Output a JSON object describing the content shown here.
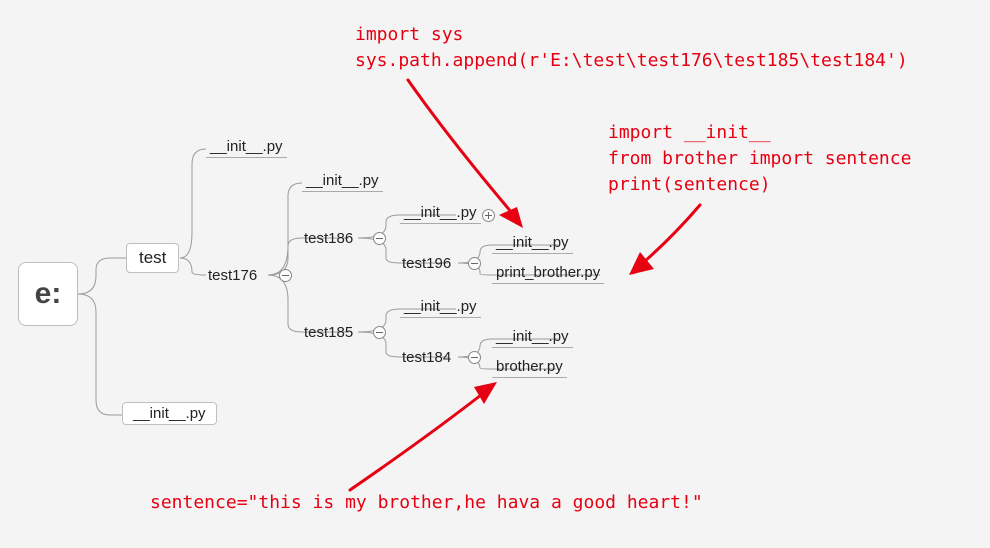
{
  "root": {
    "label": "e:"
  },
  "lvl1": {
    "test": "test",
    "init": "__init__.py"
  },
  "lvl2": {
    "init": "__init__.py",
    "test176": "test176"
  },
  "lvl3": {
    "init": "__init__.py",
    "test186": "test186",
    "test185": "test185"
  },
  "lvl4a": {
    "init": "__init__.py",
    "test196": "test196"
  },
  "lvl4b": {
    "init": "__init__.py",
    "test184": "test184"
  },
  "lvl5a": {
    "init": "__init__.py",
    "print_brother": "print_brother.py"
  },
  "lvl5b": {
    "init": "__init__.py",
    "brother": "brother.py"
  },
  "annotations": {
    "top_code_line1": "import sys",
    "top_code_line2": "sys.path.append(r'E:\\test\\test176\\test185\\test184')",
    "right_code_line1": "import __init__",
    "right_code_line2": "from brother import sentence",
    "right_code_line3": "print(sentence)",
    "bottom_code": "sentence=\"this is my brother,he hava a good heart!\""
  }
}
